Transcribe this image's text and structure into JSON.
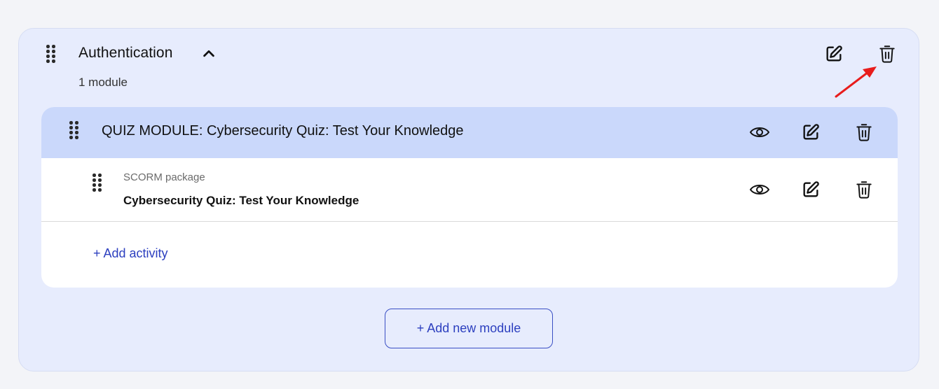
{
  "section": {
    "title": "Authentication",
    "subtitle": "1 module",
    "icons": {
      "drag": "drag-handle-icon",
      "collapse": "chevron-up-icon",
      "edit": "edit-icon",
      "delete": "trash-icon"
    }
  },
  "module": {
    "title": "QUIZ MODULE: Cybersecurity Quiz: Test Your Knowledge",
    "header_bg": "#cad8fb",
    "actions": [
      "eye-icon",
      "edit-icon",
      "trash-icon"
    ]
  },
  "activity": {
    "type": "SCORM package",
    "name": "Cybersecurity Quiz: Test Your Knowledge",
    "actions": [
      "eye-icon",
      "edit-icon",
      "trash-icon"
    ]
  },
  "add_activity_label": "+ Add activity",
  "add_module_label": "+ Add new module",
  "colors": {
    "accent": "#2c3fbf",
    "section_bg": "#e7ecfd",
    "annotation_arrow": "#e81c1c"
  }
}
